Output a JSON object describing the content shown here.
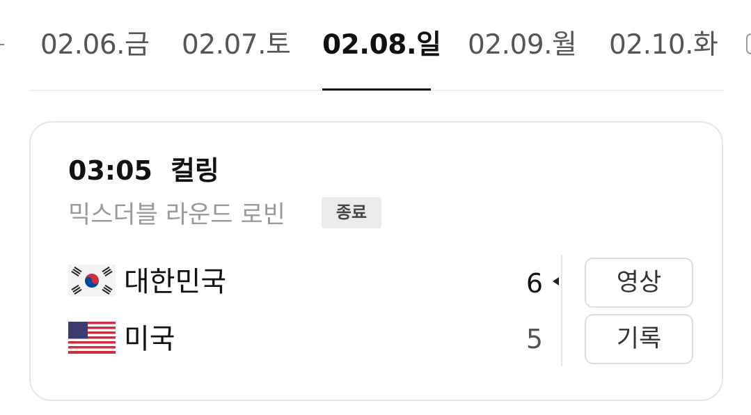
{
  "date_tabs": [
    {
      "label": "02.06.금",
      "active": false
    },
    {
      "label": "02.07.토",
      "active": false
    },
    {
      "label": "02.08.일",
      "active": true
    },
    {
      "label": "02.09.월",
      "active": false
    },
    {
      "label": "02.10.화",
      "active": false
    }
  ],
  "match": {
    "time": "03:05",
    "sport": "컬링",
    "event": "믹스더블 라운드 로빈",
    "status": "종료",
    "teams": [
      {
        "name": "대한민국",
        "score": "6",
        "flag": "korea-flag-icon",
        "winner": true
      },
      {
        "name": "미국",
        "score": "5",
        "flag": "usa-flag-icon",
        "winner": false
      }
    ],
    "buttons": {
      "video": "영상",
      "record": "기록"
    }
  },
  "colors": {
    "active_text": "#111111",
    "inactive_text": "#555555",
    "subtitle_text": "#9a9a9a",
    "badge_bg": "#ebebeb",
    "border": "#e6e6e6"
  }
}
